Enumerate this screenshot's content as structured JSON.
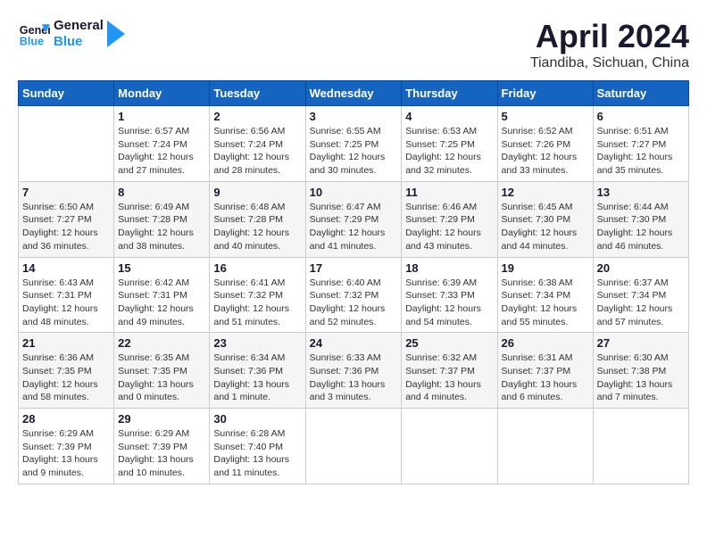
{
  "header": {
    "logo": "GeneralBlue",
    "title": "April 2024",
    "location": "Tiandiba, Sichuan, China"
  },
  "days_of_week": [
    "Sunday",
    "Monday",
    "Tuesday",
    "Wednesday",
    "Thursday",
    "Friday",
    "Saturday"
  ],
  "weeks": [
    [
      {
        "day": "",
        "info": ""
      },
      {
        "day": "1",
        "info": "Sunrise: 6:57 AM\nSunset: 7:24 PM\nDaylight: 12 hours\nand 27 minutes."
      },
      {
        "day": "2",
        "info": "Sunrise: 6:56 AM\nSunset: 7:24 PM\nDaylight: 12 hours\nand 28 minutes."
      },
      {
        "day": "3",
        "info": "Sunrise: 6:55 AM\nSunset: 7:25 PM\nDaylight: 12 hours\nand 30 minutes."
      },
      {
        "day": "4",
        "info": "Sunrise: 6:53 AM\nSunset: 7:25 PM\nDaylight: 12 hours\nand 32 minutes."
      },
      {
        "day": "5",
        "info": "Sunrise: 6:52 AM\nSunset: 7:26 PM\nDaylight: 12 hours\nand 33 minutes."
      },
      {
        "day": "6",
        "info": "Sunrise: 6:51 AM\nSunset: 7:27 PM\nDaylight: 12 hours\nand 35 minutes."
      }
    ],
    [
      {
        "day": "7",
        "info": "Sunrise: 6:50 AM\nSunset: 7:27 PM\nDaylight: 12 hours\nand 36 minutes."
      },
      {
        "day": "8",
        "info": "Sunrise: 6:49 AM\nSunset: 7:28 PM\nDaylight: 12 hours\nand 38 minutes."
      },
      {
        "day": "9",
        "info": "Sunrise: 6:48 AM\nSunset: 7:28 PM\nDaylight: 12 hours\nand 40 minutes."
      },
      {
        "day": "10",
        "info": "Sunrise: 6:47 AM\nSunset: 7:29 PM\nDaylight: 12 hours\nand 41 minutes."
      },
      {
        "day": "11",
        "info": "Sunrise: 6:46 AM\nSunset: 7:29 PM\nDaylight: 12 hours\nand 43 minutes."
      },
      {
        "day": "12",
        "info": "Sunrise: 6:45 AM\nSunset: 7:30 PM\nDaylight: 12 hours\nand 44 minutes."
      },
      {
        "day": "13",
        "info": "Sunrise: 6:44 AM\nSunset: 7:30 PM\nDaylight: 12 hours\nand 46 minutes."
      }
    ],
    [
      {
        "day": "14",
        "info": "Sunrise: 6:43 AM\nSunset: 7:31 PM\nDaylight: 12 hours\nand 48 minutes."
      },
      {
        "day": "15",
        "info": "Sunrise: 6:42 AM\nSunset: 7:31 PM\nDaylight: 12 hours\nand 49 minutes."
      },
      {
        "day": "16",
        "info": "Sunrise: 6:41 AM\nSunset: 7:32 PM\nDaylight: 12 hours\nand 51 minutes."
      },
      {
        "day": "17",
        "info": "Sunrise: 6:40 AM\nSunset: 7:32 PM\nDaylight: 12 hours\nand 52 minutes."
      },
      {
        "day": "18",
        "info": "Sunrise: 6:39 AM\nSunset: 7:33 PM\nDaylight: 12 hours\nand 54 minutes."
      },
      {
        "day": "19",
        "info": "Sunrise: 6:38 AM\nSunset: 7:34 PM\nDaylight: 12 hours\nand 55 minutes."
      },
      {
        "day": "20",
        "info": "Sunrise: 6:37 AM\nSunset: 7:34 PM\nDaylight: 12 hours\nand 57 minutes."
      }
    ],
    [
      {
        "day": "21",
        "info": "Sunrise: 6:36 AM\nSunset: 7:35 PM\nDaylight: 12 hours\nand 58 minutes."
      },
      {
        "day": "22",
        "info": "Sunrise: 6:35 AM\nSunset: 7:35 PM\nDaylight: 13 hours\nand 0 minutes."
      },
      {
        "day": "23",
        "info": "Sunrise: 6:34 AM\nSunset: 7:36 PM\nDaylight: 13 hours\nand 1 minute."
      },
      {
        "day": "24",
        "info": "Sunrise: 6:33 AM\nSunset: 7:36 PM\nDaylight: 13 hours\nand 3 minutes."
      },
      {
        "day": "25",
        "info": "Sunrise: 6:32 AM\nSunset: 7:37 PM\nDaylight: 13 hours\nand 4 minutes."
      },
      {
        "day": "26",
        "info": "Sunrise: 6:31 AM\nSunset: 7:37 PM\nDaylight: 13 hours\nand 6 minutes."
      },
      {
        "day": "27",
        "info": "Sunrise: 6:30 AM\nSunset: 7:38 PM\nDaylight: 13 hours\nand 7 minutes."
      }
    ],
    [
      {
        "day": "28",
        "info": "Sunrise: 6:29 AM\nSunset: 7:39 PM\nDaylight: 13 hours\nand 9 minutes."
      },
      {
        "day": "29",
        "info": "Sunrise: 6:29 AM\nSunset: 7:39 PM\nDaylight: 13 hours\nand 10 minutes."
      },
      {
        "day": "30",
        "info": "Sunrise: 6:28 AM\nSunset: 7:40 PM\nDaylight: 13 hours\nand 11 minutes."
      },
      {
        "day": "",
        "info": ""
      },
      {
        "day": "",
        "info": ""
      },
      {
        "day": "",
        "info": ""
      },
      {
        "day": "",
        "info": ""
      }
    ]
  ]
}
